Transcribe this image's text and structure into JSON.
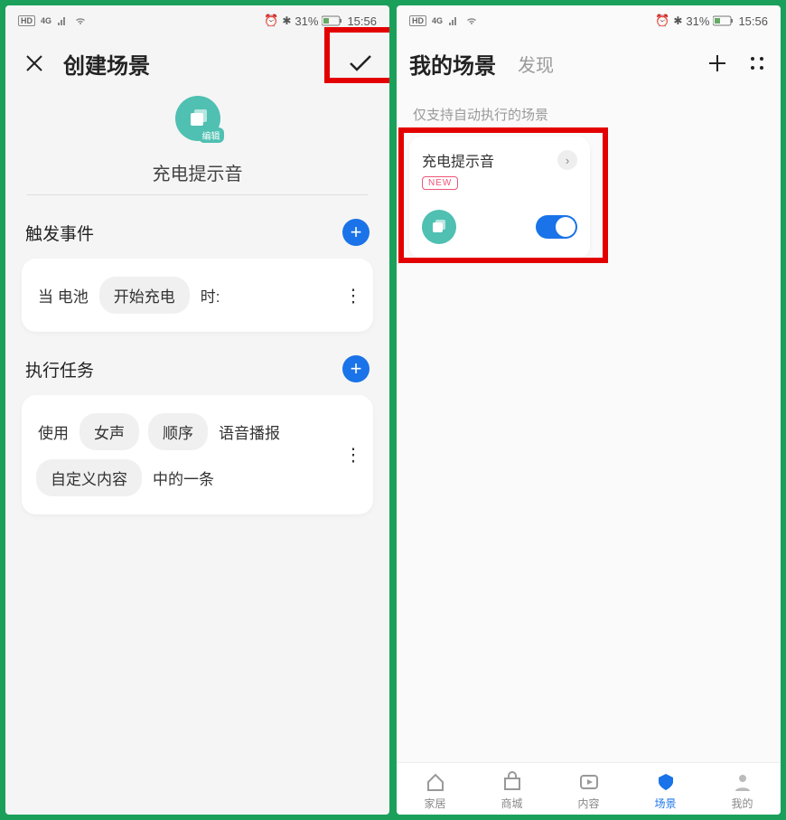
{
  "status": {
    "net_badge": "HD",
    "net_badge2": "4G",
    "battery_text": "31%",
    "time": "15:56"
  },
  "left": {
    "header_title": "创建场景",
    "scene_name": "充电提示音",
    "edit_label": "编辑",
    "section_trigger": "触发事件",
    "section_task": "执行任务",
    "trigger_plain1": "当 电池",
    "trigger_chip1": "开始充电",
    "trigger_plain2": "时:",
    "task_plain1": "使用",
    "task_chip1": "女声",
    "task_chip2": "顺序",
    "task_plain2": "语音播报",
    "task_chip3": "自定义内容",
    "task_plain3": "中的一条"
  },
  "right": {
    "header_title": "我的场景",
    "header_sub": "发现",
    "subhint": "仅支持自动执行的场景",
    "card_title": "充电提示音",
    "badge": "NEW",
    "nav": {
      "home": "家居",
      "mall": "商城",
      "content": "内容",
      "scene": "场景",
      "mine": "我的"
    }
  }
}
